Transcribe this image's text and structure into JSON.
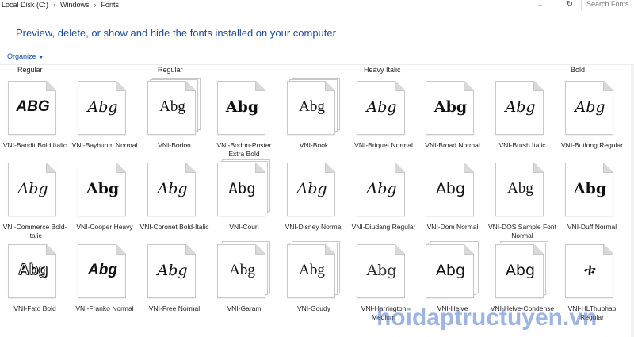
{
  "breadcrumb": [
    "Local Disk (C:)",
    "Windows",
    "Fonts"
  ],
  "search": {
    "placeholder": "Search Fonts"
  },
  "page_title": "Preview, delete, or show and hide the fonts installed on your computer",
  "toolbar": {
    "organize_label": "Organize"
  },
  "row_labels": [
    "Regular",
    "Regular",
    "Heavy Italic",
    "Bold"
  ],
  "fonts": [
    {
      "name": "VNI-Bandit Bold Italic",
      "sample": "ABG",
      "style": "s-heavy",
      "stack": 1
    },
    {
      "name": "VNI-Baybuom Normal",
      "sample": "Abg",
      "style": "s-script",
      "stack": 1
    },
    {
      "name": "VNI-Bodon",
      "sample": "Abg",
      "style": "s-serif",
      "stack": 3
    },
    {
      "name": "VNI-Bodon-Poster Extra Bold",
      "sample": "Abg",
      "style": "s-bold",
      "stack": 1
    },
    {
      "name": "VNI-Book",
      "sample": "Abg",
      "style": "s-serif",
      "stack": 3
    },
    {
      "name": "VNI-Briquet Normal",
      "sample": "Abg",
      "style": "s-script",
      "stack": 1
    },
    {
      "name": "VNI-Broad Normal",
      "sample": "Abg",
      "style": "s-bold",
      "stack": 1
    },
    {
      "name": "VNI-Brush Italic",
      "sample": "Abg",
      "style": "s-script",
      "stack": 1
    },
    {
      "name": "VNI-Butlong Regular",
      "sample": "Abg",
      "style": "s-script",
      "stack": 1
    },
    {
      "name": "VNI-Commerce Bold-Italic",
      "sample": "Abg",
      "style": "s-script",
      "stack": 1
    },
    {
      "name": "VNI-Cooper Heavy",
      "sample": "Abg",
      "style": "s-bold",
      "stack": 1
    },
    {
      "name": "VNI-Coronet Bold-Italic",
      "sample": "Abg",
      "style": "s-script",
      "stack": 1
    },
    {
      "name": "VNI-Couri",
      "sample": "Abg",
      "style": "s-mono",
      "stack": 3
    },
    {
      "name": "VNI-Disney Normal",
      "sample": "Abg",
      "style": "s-script",
      "stack": 1
    },
    {
      "name": "VNI-Diudang Regular",
      "sample": "Abg",
      "style": "s-script",
      "stack": 1
    },
    {
      "name": "VNI-Dom Normal",
      "sample": "Abg",
      "style": "s-sans",
      "stack": 1
    },
    {
      "name": "VNI-DOS Sample Font Normal",
      "sample": "Abg",
      "style": "s-serif",
      "stack": 1
    },
    {
      "name": "VNI-Duff Normal",
      "sample": "Abg",
      "style": "s-bold",
      "stack": 1
    },
    {
      "name": "VNI-Fato Bold",
      "sample": "Abg",
      "style": "s-outline",
      "stack": 1
    },
    {
      "name": "VNI-Franko Normal",
      "sample": "Abg",
      "style": "s-heavy",
      "stack": 1
    },
    {
      "name": "VNI-Free Normal",
      "sample": "Abg",
      "style": "s-script",
      "stack": 1
    },
    {
      "name": "VNI-Garam",
      "sample": "Abg",
      "style": "s-serif",
      "stack": 3
    },
    {
      "name": "VNI-Goudy",
      "sample": "Abg",
      "style": "s-serif",
      "stack": 3
    },
    {
      "name": "VNI-Harrington Medium",
      "sample": "Abg",
      "style": "s-light",
      "stack": 1
    },
    {
      "name": "VNI-Helve",
      "sample": "Abg",
      "style": "s-sans",
      "stack": 3
    },
    {
      "name": "VNI-Helve-Condense",
      "sample": "Abg",
      "style": "s-sans",
      "stack": 3
    },
    {
      "name": "VNI-HLThuphap Regular",
      "sample": "ቱ",
      "style": "s-glyph",
      "stack": 1
    }
  ],
  "watermark": "hoidaptructuyen.vn",
  "colors": {
    "link_blue": "#1a4da1",
    "page_border": "#c8c8c8"
  }
}
